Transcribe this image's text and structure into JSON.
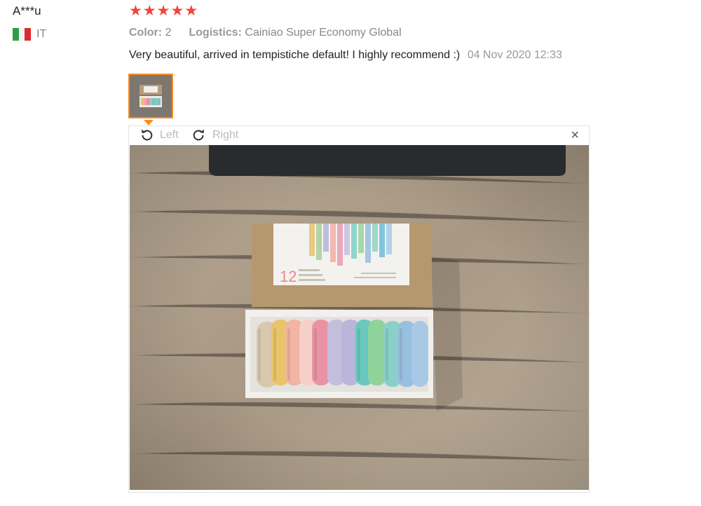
{
  "review": {
    "user": "A***u",
    "country": "IT",
    "rating": 5,
    "color_label": "Color:",
    "color_value": "2",
    "logistics_label": "Logistics:",
    "logistics_value": "Cainiao Super Economy Global",
    "comment": "Very beautiful, arrived in tempistiche default! I highly recommend :)",
    "date": "04 Nov 2020 12:33"
  },
  "viewer": {
    "rotate_left": "Left",
    "rotate_right": "Right",
    "close": "×"
  },
  "photo": {
    "box_label_number": "12"
  },
  "colors": {
    "star": "#f0453a",
    "thumb_border": "#ff8b1f",
    "flag": [
      "#2e9b45",
      "#ffffff",
      "#d92b2b"
    ]
  }
}
